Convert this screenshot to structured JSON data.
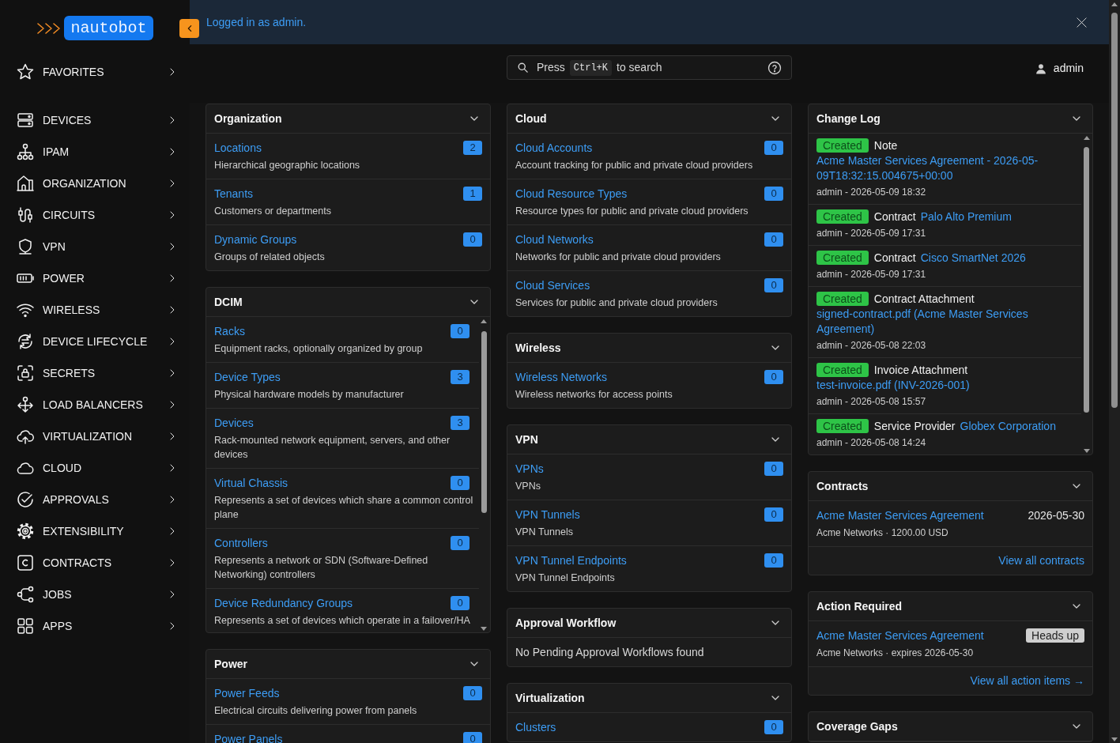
{
  "sidebar": {
    "logo": {
      "name": "nautobot"
    },
    "favorites": {
      "label": "FAVORITES"
    },
    "items": [
      "DEVICES",
      "IPAM",
      "ORGANIZATION",
      "CIRCUITS",
      "VPN",
      "POWER",
      "WIRELESS",
      "DEVICE LIFECYCLE",
      "SECRETS",
      "LOAD BALANCERS",
      "VIRTUALIZATION",
      "CLOUD",
      "APPROVALS",
      "EXTENSIBILITY",
      "CONTRACTS",
      "JOBS",
      "APPS"
    ]
  },
  "alert": {
    "message": "Logged in as admin."
  },
  "search": {
    "prefix": "Press",
    "shortcut": "Ctrl+K",
    "suffix": "to search"
  },
  "user": {
    "name": "admin"
  },
  "columns": [
    {
      "panels": [
        {
          "title": "Organization",
          "kind": "list",
          "items": [
            {
              "label": "Locations",
              "count": "2",
              "description": "Hierarchical geographic locations"
            },
            {
              "label": "Tenants",
              "count": "1",
              "description": "Customers or departments"
            },
            {
              "label": "Dynamic Groups",
              "count": "0",
              "description": "Groups of related objects"
            }
          ]
        },
        {
          "title": "DCIM",
          "kind": "scroll_list",
          "items": [
            {
              "label": "Racks",
              "count": "0",
              "description": "Equipment racks, optionally organized by group"
            },
            {
              "label": "Device Types",
              "count": "3",
              "description": "Physical hardware models by manufacturer"
            },
            {
              "label": "Devices",
              "count": "3",
              "description": "Rack-mounted network equipment, servers, and other devices"
            },
            {
              "label": "Virtual Chassis",
              "count": "0",
              "description": "Represents a set of devices which share a common control plane"
            },
            {
              "label": "Controllers",
              "count": "0",
              "description": "Represents a network or SDN (Software-Defined Networking) controllers"
            },
            {
              "label": "Device Redundancy Groups",
              "count": "0",
              "description": "Represents a set of devices which operate in a failover/HA"
            }
          ]
        },
        {
          "title": "Power",
          "kind": "list",
          "items": [
            {
              "label": "Power Feeds",
              "count": "0",
              "description": "Electrical circuits delivering power from panels"
            },
            {
              "label": "Power Panels",
              "count": "0"
            }
          ]
        }
      ]
    },
    {
      "panels": [
        {
          "title": "Cloud",
          "kind": "list",
          "items": [
            {
              "label": "Cloud Accounts",
              "count": "0",
              "description": "Account tracking for public and private cloud providers"
            },
            {
              "label": "Cloud Resource Types",
              "count": "0",
              "description": "Resource types for public and private cloud providers"
            },
            {
              "label": "Cloud Networks",
              "count": "0",
              "description": "Networks for public and private cloud providers"
            },
            {
              "label": "Cloud Services",
              "count": "0",
              "description": "Services for public and private cloud providers"
            }
          ]
        },
        {
          "title": "Wireless",
          "kind": "list",
          "items": [
            {
              "label": "Wireless Networks",
              "count": "0",
              "description": "Wireless networks for access points"
            }
          ]
        },
        {
          "title": "VPN",
          "kind": "list",
          "items": [
            {
              "label": "VPNs",
              "count": "0",
              "description": "VPNs"
            },
            {
              "label": "VPN Tunnels",
              "count": "0",
              "description": "VPN Tunnels"
            },
            {
              "label": "VPN Tunnel Endpoints",
              "count": "0",
              "description": "VPN Tunnel Endpoints"
            }
          ]
        },
        {
          "title": "Approval Workflow",
          "kind": "message",
          "message": "No Pending Approval Workflows found"
        },
        {
          "title": "Virtualization",
          "kind": "list",
          "items": [
            {
              "label": "Clusters",
              "count": "0"
            }
          ]
        }
      ]
    },
    {
      "panels": [
        {
          "title": "Change Log",
          "kind": "changelog",
          "entries": [
            {
              "action": "Created",
              "object_type": "Note",
              "object": "Acme Master Services Agreement - 2026-05-09T18:32:15.004675+00:00",
              "meta": "admin - 2026-05-09 18:32"
            },
            {
              "action": "Created",
              "object_type": "Contract",
              "object": "Palo Alto Premium",
              "meta": "admin - 2026-05-09 17:31"
            },
            {
              "action": "Created",
              "object_type": "Contract",
              "object": "Cisco SmartNet 2026",
              "meta": "admin - 2026-05-09 17:31"
            },
            {
              "action": "Created",
              "object_type": "Contract Attachment",
              "object": "signed-contract.pdf (Acme Master Services Agreement)",
              "meta": "admin - 2026-05-08 22:03"
            },
            {
              "action": "Created",
              "object_type": "Invoice Attachment",
              "object": "test-invoice.pdf (INV-2026-001)",
              "meta": "admin - 2026-05-08 15:57"
            },
            {
              "action": "Created",
              "object_type": "Service Provider",
              "object": "Globex Corporation",
              "meta": "admin - 2026-05-08 14:24"
            }
          ]
        },
        {
          "title": "Contracts",
          "kind": "summary",
          "items": [
            {
              "name": "Acme Master Services Agreement",
              "date": "2026-05-30",
              "meta": "Acme Networks · 1200.00 USD"
            }
          ],
          "footer_link": "View all contracts"
        },
        {
          "title": "Action Required",
          "kind": "summary",
          "items": [
            {
              "name": "Acme Master Services Agreement",
              "badge": "Heads up",
              "meta": "Acme Networks · expires 2026-05-30"
            }
          ],
          "footer_link": "View all action items →"
        },
        {
          "title": "Coverage Gaps",
          "kind": "list"
        }
      ]
    }
  ]
}
